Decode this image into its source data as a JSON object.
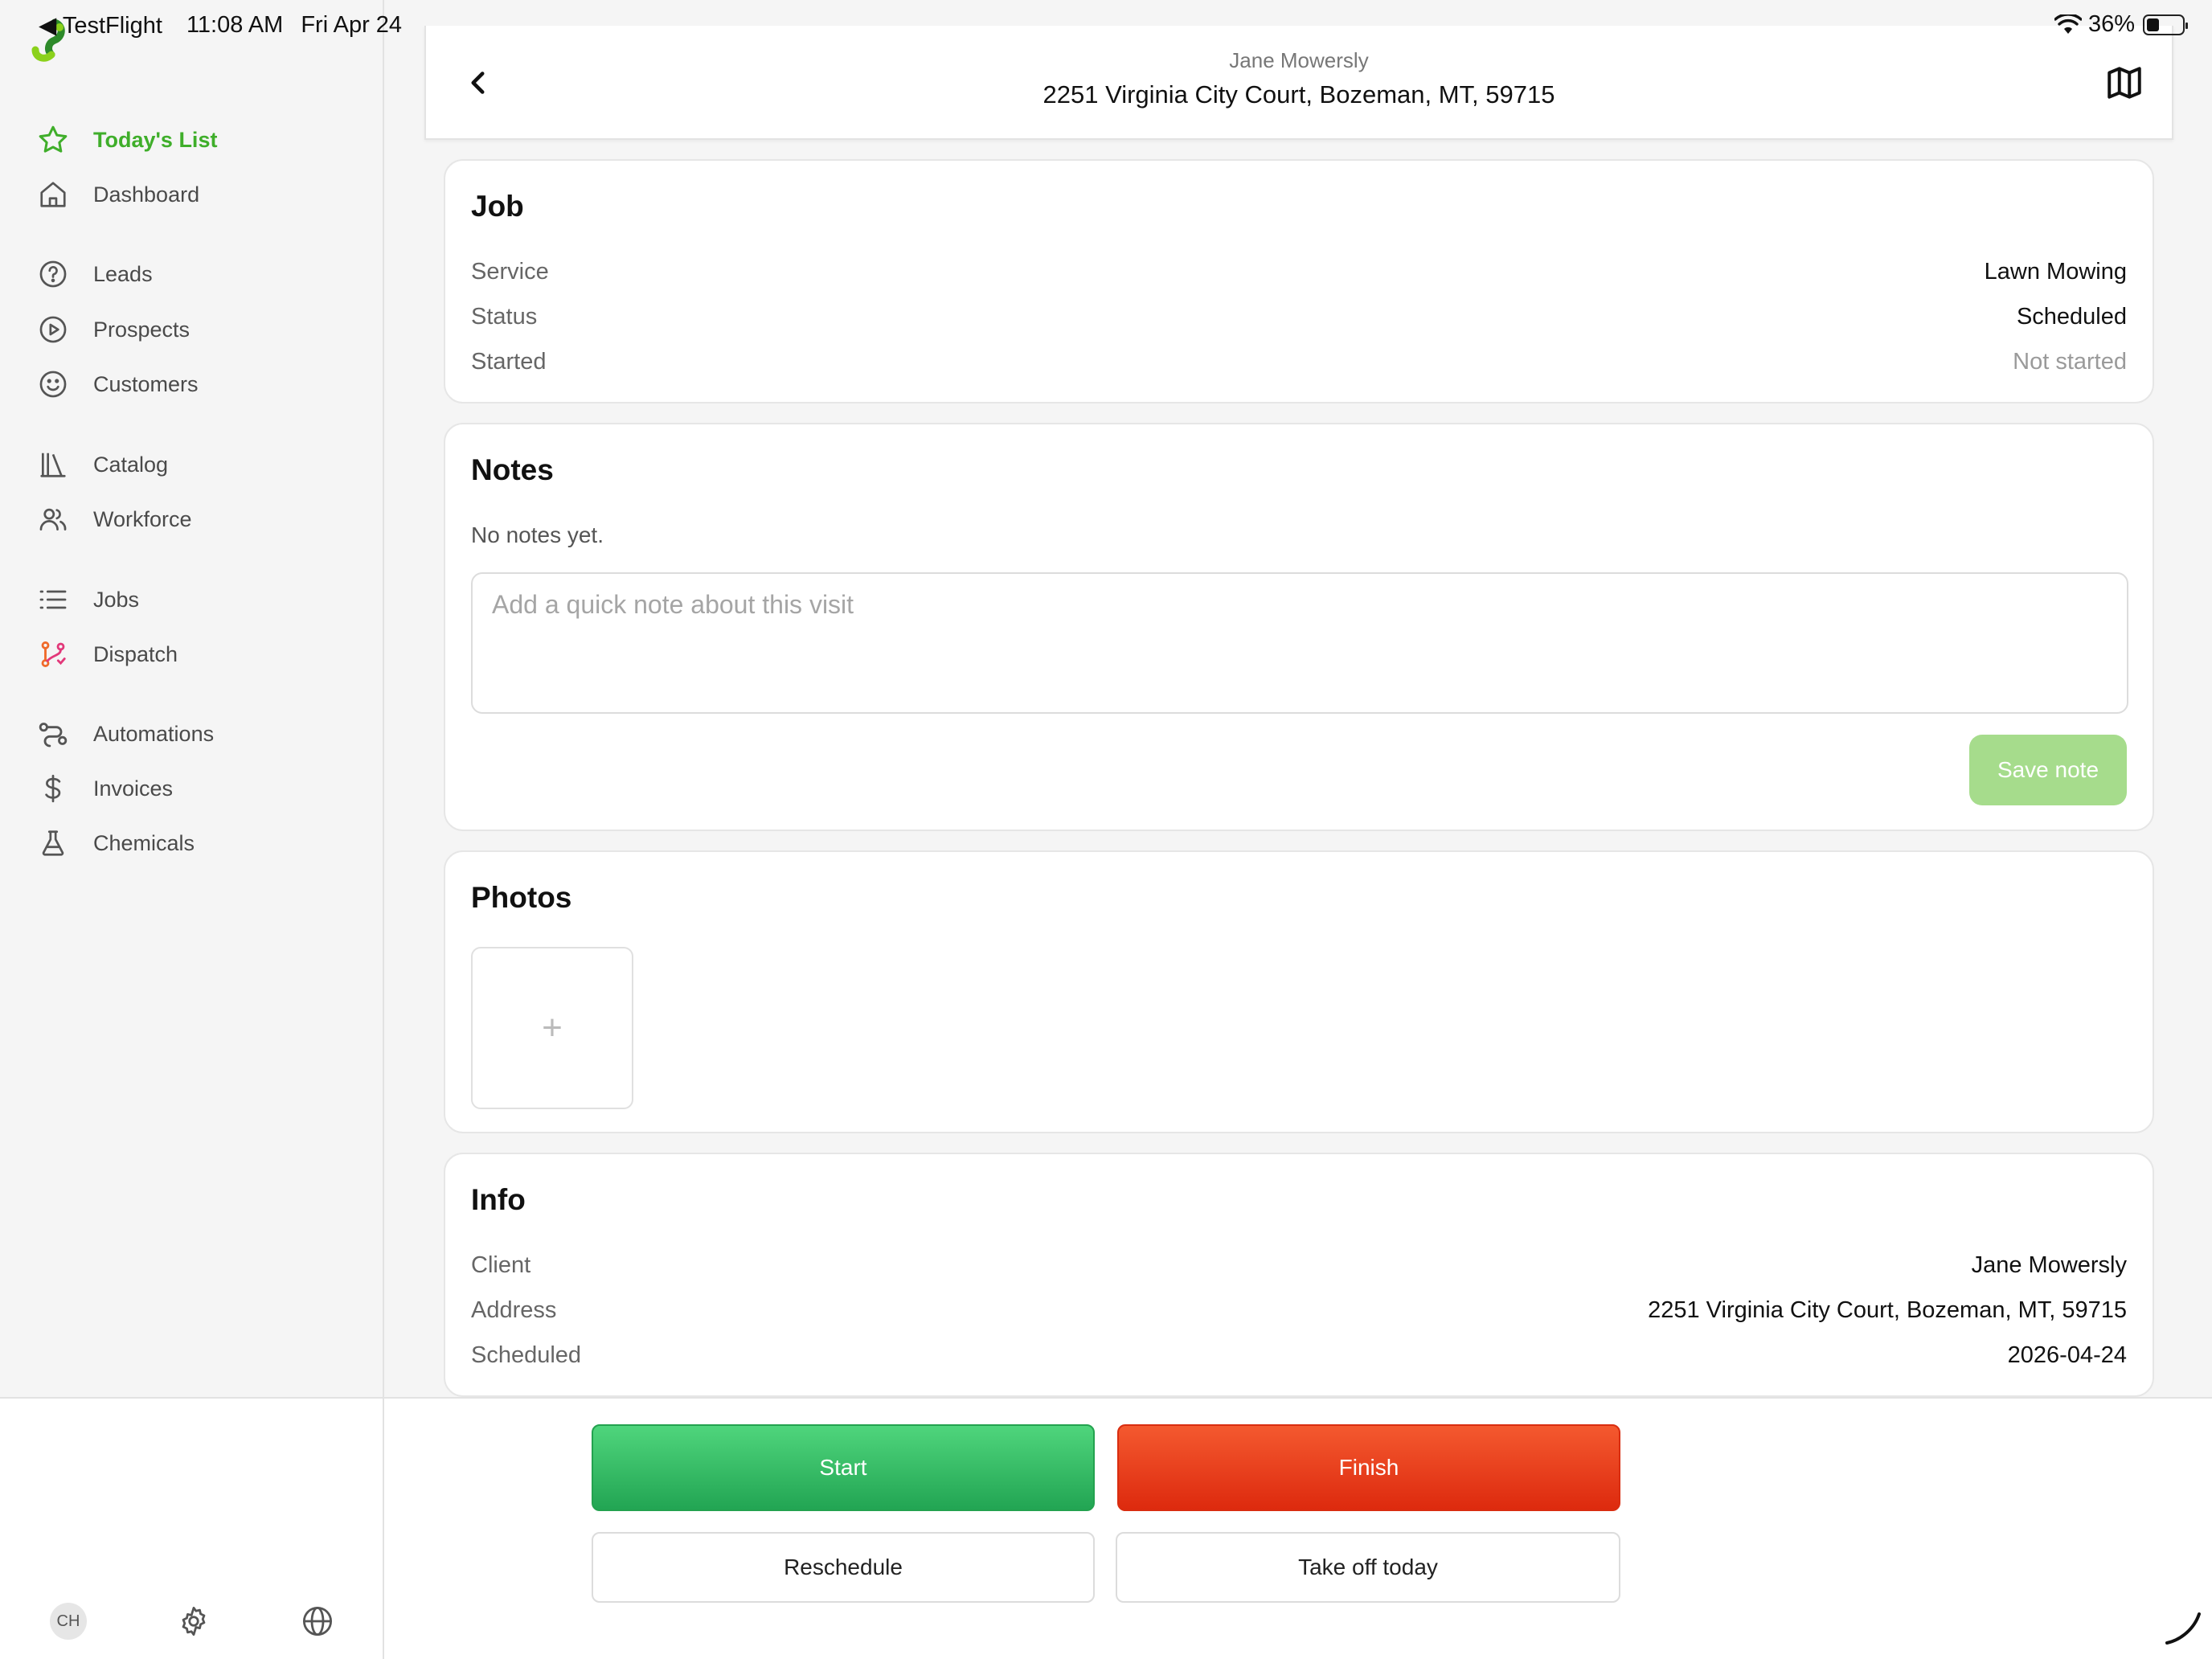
{
  "status_bar": {
    "back_app": "◀ TestFlight",
    "time": "11:08 AM",
    "date": "Fri Apr 24",
    "battery": "36%",
    "battery_level": 0.36
  },
  "sidebar": {
    "items": [
      {
        "label": "Today's List",
        "icon": "star-icon",
        "active": true
      },
      {
        "label": "Dashboard",
        "icon": "home-icon"
      },
      {
        "label": "Leads",
        "icon": "question-circle-icon"
      },
      {
        "label": "Prospects",
        "icon": "play-circle-icon"
      },
      {
        "label": "Customers",
        "icon": "smile-icon"
      },
      {
        "label": "Catalog",
        "icon": "books-icon"
      },
      {
        "label": "Workforce",
        "icon": "users-icon"
      },
      {
        "label": "Jobs",
        "icon": "list-icon"
      },
      {
        "label": "Dispatch",
        "icon": "git-branch-icon"
      },
      {
        "label": "Automations",
        "icon": "route-icon"
      },
      {
        "label": "Invoices",
        "icon": "dollar-icon"
      },
      {
        "label": "Chemicals",
        "icon": "flask-icon"
      }
    ],
    "footer": {
      "avatar_initials": "CH",
      "settings_icon": "gear-icon",
      "language_icon": "globe-icon"
    }
  },
  "header": {
    "client": "Jane Mowersly",
    "address": "2251 Virginia City Court, Bozeman, MT, 59715",
    "back_icon": "chevron-left-icon",
    "map_icon": "map-icon"
  },
  "job": {
    "title": "Job",
    "rows": [
      {
        "label": "Service",
        "value": "Lawn Mowing"
      },
      {
        "label": "Status",
        "value": "Scheduled"
      },
      {
        "label": "Started",
        "value": "Not started",
        "muted": true
      }
    ]
  },
  "notes": {
    "title": "Notes",
    "empty_text": "No notes yet.",
    "placeholder": "Add a quick note about this visit",
    "value": "",
    "save_label": "Save note"
  },
  "photos": {
    "title": "Photos",
    "add_label": "+"
  },
  "info": {
    "title": "Info",
    "rows": [
      {
        "label": "Client",
        "value": "Jane Mowersly"
      },
      {
        "label": "Address",
        "value": "2251 Virginia City Court, Bozeman, MT, 59715"
      },
      {
        "label": "Scheduled",
        "value": "2026-04-24"
      }
    ]
  },
  "actions": {
    "start": "Start",
    "finish": "Finish",
    "reschedule": "Reschedule",
    "take_off": "Take off today"
  },
  "colors": {
    "accent_green": "#3fae2a",
    "start_green": "#2dbb5f",
    "finish_red": "#e8401c",
    "save_disabled": "#a6dc8c"
  }
}
